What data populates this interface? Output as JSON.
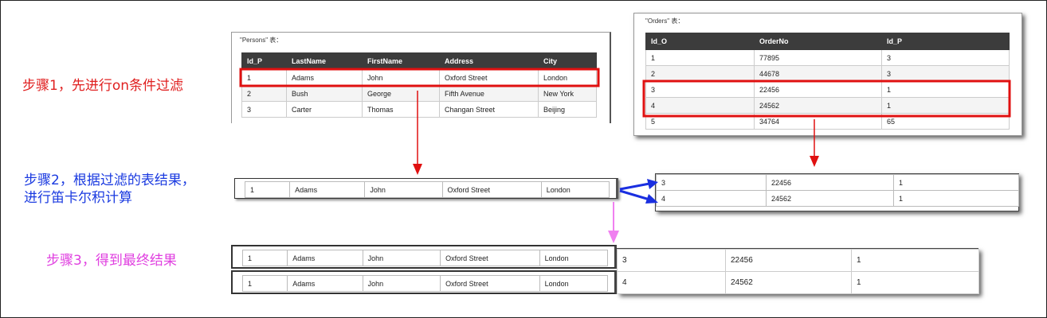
{
  "steps": {
    "step1": "步骤1，先进行on条件过滤",
    "step2_line1": "步骤2，根据过滤的表结果，",
    "step2_line2": "进行笛卡尔积计算",
    "step3": "步骤3，得到最终结果"
  },
  "persons": {
    "caption": "\"Persons\" 表：",
    "headers": [
      "Id_P",
      "LastName",
      "FirstName",
      "Address",
      "City"
    ],
    "rows": [
      [
        "1",
        "Adams",
        "John",
        "Oxford Street",
        "London"
      ],
      [
        "2",
        "Bush",
        "George",
        "Fifth Avenue",
        "New York"
      ],
      [
        "3",
        "Carter",
        "Thomas",
        "Changan Street",
        "Beijing"
      ]
    ]
  },
  "orders": {
    "caption": "\"Orders\" 表：",
    "headers": [
      "Id_O",
      "OrderNo",
      "Id_P"
    ],
    "rows": [
      [
        "1",
        "77895",
        "3"
      ],
      [
        "2",
        "44678",
        "3"
      ],
      [
        "3",
        "22456",
        "1"
      ],
      [
        "4",
        "24562",
        "1"
      ],
      [
        "5",
        "34764",
        "65"
      ]
    ]
  },
  "step2_persons_row": [
    "1",
    "Adams",
    "John",
    "Oxford Street",
    "London"
  ],
  "step2_orders_rows": [
    [
      "3",
      "22456",
      "1"
    ],
    [
      "4",
      "24562",
      "1"
    ]
  ],
  "result_persons_rows": [
    [
      "1",
      "Adams",
      "John",
      "Oxford Street",
      "London"
    ],
    [
      "1",
      "Adams",
      "John",
      "Oxford Street",
      "London"
    ]
  ],
  "result_orders_rows": [
    [
      "3",
      "22456",
      "1"
    ],
    [
      "4",
      "24562",
      "1"
    ]
  ],
  "colors": {
    "step1": "#e02020",
    "step2": "#1a3ae0",
    "step3": "#e040e0",
    "highlight": "#e01010",
    "header_bg": "#3c3c3c"
  }
}
